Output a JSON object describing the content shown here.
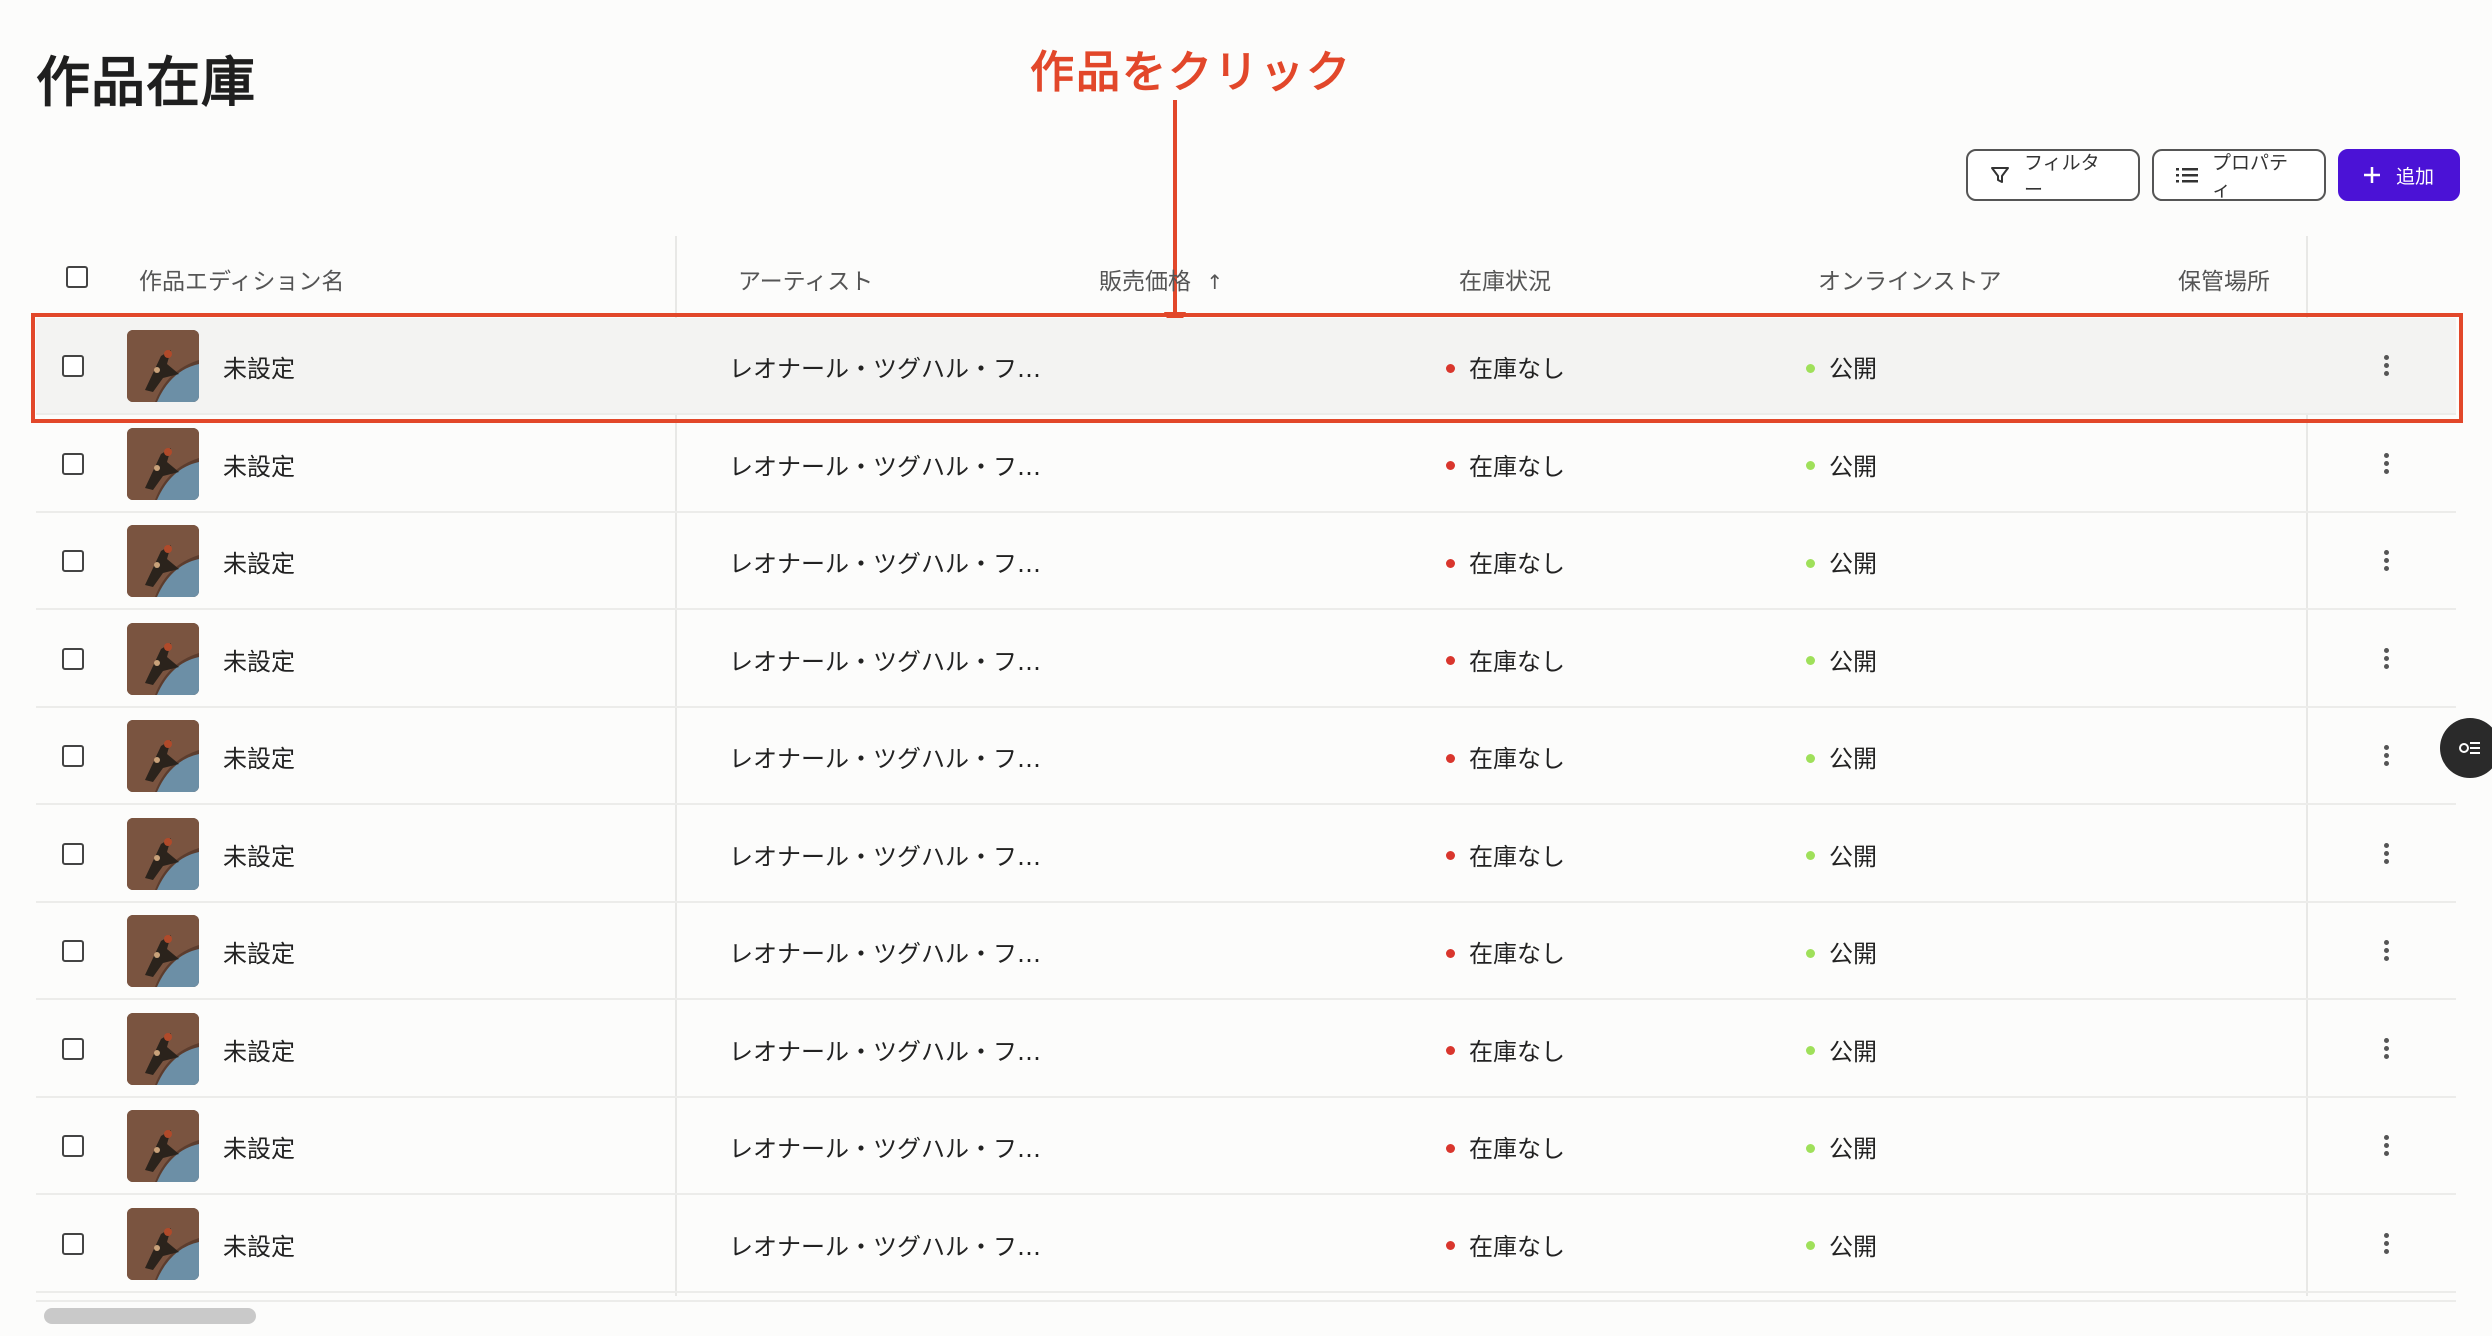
{
  "page": {
    "title": "作品在庫"
  },
  "annotation": {
    "label": "作品をクリック",
    "color": "#e2472a"
  },
  "toolbar": {
    "filter_label": "フィルター",
    "properties_label": "プロパティ",
    "add_label": "追加",
    "add_color": "#4b12d6"
  },
  "table": {
    "columns": {
      "name": "作品エディション名",
      "artist": "アーティスト",
      "price": "販売価格",
      "stock": "在庫状況",
      "store": "オンラインストア",
      "location": "保管場所"
    },
    "price_sort": "ascending",
    "rows": [
      {
        "name": "未設定",
        "artist": "レオナール・ツグハル・フ…",
        "stock": "在庫なし",
        "store": "公開"
      },
      {
        "name": "未設定",
        "artist": "レオナール・ツグハル・フ…",
        "stock": "在庫なし",
        "store": "公開"
      },
      {
        "name": "未設定",
        "artist": "レオナール・ツグハル・フ…",
        "stock": "在庫なし",
        "store": "公開"
      },
      {
        "name": "未設定",
        "artist": "レオナール・ツグハル・フ…",
        "stock": "在庫なし",
        "store": "公開"
      },
      {
        "name": "未設定",
        "artist": "レオナール・ツグハル・フ…",
        "stock": "在庫なし",
        "store": "公開"
      },
      {
        "name": "未設定",
        "artist": "レオナール・ツグハル・フ…",
        "stock": "在庫なし",
        "store": "公開"
      },
      {
        "name": "未設定",
        "artist": "レオナール・ツグハル・フ…",
        "stock": "在庫なし",
        "store": "公開"
      },
      {
        "name": "未設定",
        "artist": "レオナール・ツグハル・フ…",
        "stock": "在庫なし",
        "store": "公開"
      },
      {
        "name": "未設定",
        "artist": "レオナール・ツグハル・フ…",
        "stock": "在庫なし",
        "store": "公開"
      },
      {
        "name": "未設定",
        "artist": "レオナール・ツグハル・フ…",
        "stock": "在庫なし",
        "store": "公開"
      }
    ],
    "status_colors": {
      "out_of_stock": "#d9362d",
      "published": "#9fe05a"
    }
  }
}
